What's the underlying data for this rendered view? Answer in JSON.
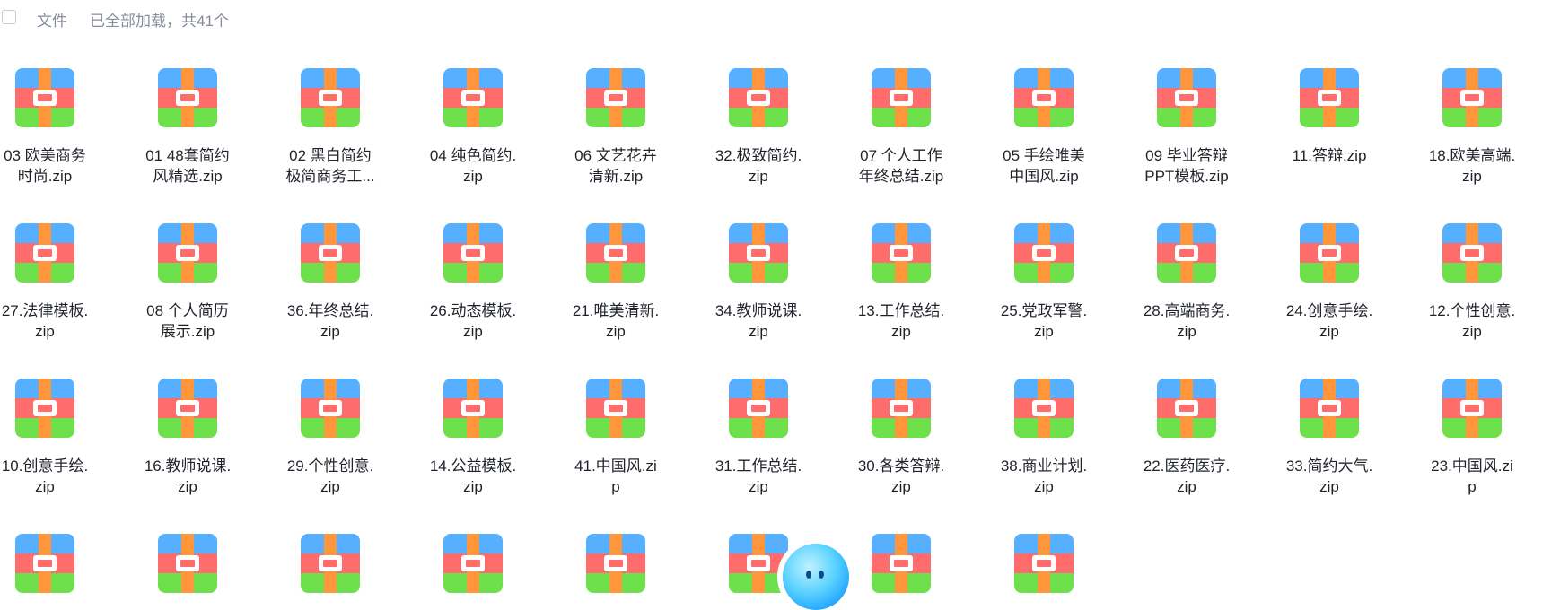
{
  "header": {
    "checkbox_label": "",
    "column_name": "文件",
    "status": "已全部加载，共41个"
  },
  "icon_colors": {
    "top": "#57afff",
    "middle": "#ff6c6c",
    "bottom": "#6ee04c",
    "strap": "#ff963c"
  },
  "files": [
    {
      "line1": "03 欧美商务",
      "line2": "时尚.zip"
    },
    {
      "line1": "01 48套简约",
      "line2": "风精选.zip"
    },
    {
      "line1": "02 黑白简约",
      "line2": "极简商务工..."
    },
    {
      "line1": "04 纯色简约.",
      "line2": "zip"
    },
    {
      "line1": "06 文艺花卉",
      "line2": "清新.zip"
    },
    {
      "line1": "32.极致简约.",
      "line2": "zip"
    },
    {
      "line1": "07 个人工作",
      "line2": "年终总结.zip"
    },
    {
      "line1": "05 手绘唯美",
      "line2": "中国风.zip"
    },
    {
      "line1": "09 毕业答辩",
      "line2": "PPT模板.zip"
    },
    {
      "line1": "11.答辩.zip",
      "line2": ""
    },
    {
      "line1": "18.欧美高端.",
      "line2": "zip"
    },
    {
      "line1": "27.法律模板.",
      "line2": "zip"
    },
    {
      "line1": "08 个人简历",
      "line2": "展示.zip"
    },
    {
      "line1": "36.年终总结.",
      "line2": "zip"
    },
    {
      "line1": "26.动态模板.",
      "line2": "zip"
    },
    {
      "line1": "21.唯美清新.",
      "line2": "zip"
    },
    {
      "line1": "34.教师说课.",
      "line2": "zip"
    },
    {
      "line1": "13.工作总结.",
      "line2": "zip"
    },
    {
      "line1": "25.党政军警.",
      "line2": "zip"
    },
    {
      "line1": "28.高端商务.",
      "line2": "zip"
    },
    {
      "line1": "24.创意手绘.",
      "line2": "zip"
    },
    {
      "line1": "12.个性创意.",
      "line2": "zip"
    },
    {
      "line1": "10.创意手绘.",
      "line2": "zip"
    },
    {
      "line1": "16.教师说课.",
      "line2": "zip"
    },
    {
      "line1": "29.个性创意.",
      "line2": "zip"
    },
    {
      "line1": "14.公益模板.",
      "line2": "zip"
    },
    {
      "line1": "41.中国风.zi",
      "line2": "p"
    },
    {
      "line1": "31.工作总结.",
      "line2": "zip"
    },
    {
      "line1": "30.各类答辩.",
      "line2": "zip"
    },
    {
      "line1": "38.商业计划.",
      "line2": "zip"
    },
    {
      "line1": "22.医药医疗.",
      "line2": "zip"
    },
    {
      "line1": "33.简约大气.",
      "line2": "zip"
    },
    {
      "line1": "23.中国风.zi",
      "line2": "p"
    },
    {
      "line1": "",
      "line2": ""
    },
    {
      "line1": "",
      "line2": ""
    },
    {
      "line1": "",
      "line2": ""
    },
    {
      "line1": "",
      "line2": ""
    },
    {
      "line1": "",
      "line2": ""
    },
    {
      "line1": "",
      "line2": ""
    },
    {
      "line1": "",
      "line2": ""
    },
    {
      "line1": "",
      "line2": ""
    }
  ],
  "assistant": {
    "icon": "ai-assistant-bubble-icon"
  }
}
